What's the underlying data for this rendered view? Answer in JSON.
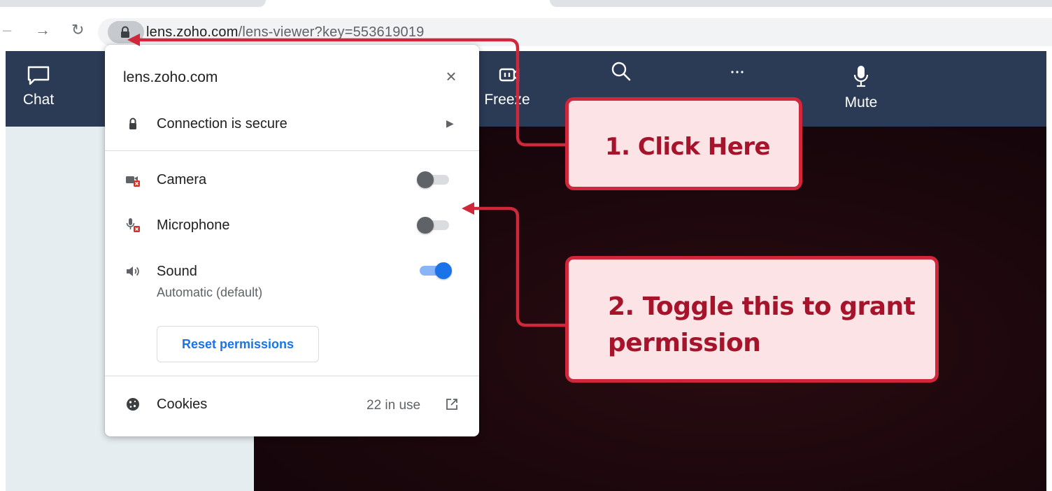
{
  "browser": {
    "url_host": "lens.zoho.com",
    "url_path": "/lens-viewer?key=553619019"
  },
  "app_header": {
    "chat_label": "Chat",
    "freeze_label": "Freeze",
    "mute_label": "Mute"
  },
  "popup": {
    "title": "lens.zoho.com",
    "close_glyph": "×",
    "connection_label": "Connection is secure",
    "permissions": [
      {
        "label": "Camera",
        "enabled": false,
        "icon": "camera-blocked-icon"
      },
      {
        "label": "Microphone",
        "enabled": false,
        "icon": "microphone-blocked-icon"
      },
      {
        "label": "Sound",
        "sublabel": "Automatic (default)",
        "enabled": true,
        "icon": "speaker-icon"
      }
    ],
    "reset_label": "Reset permissions",
    "cookies_label": "Cookies",
    "cookies_count": "22 in use"
  },
  "annotations": {
    "step1": "1. Click Here",
    "step2": "2. Toggle this to grant permission"
  },
  "colors": {
    "header_bg": "#2b3a55",
    "annotation_red": "#d0273a",
    "annotation_fill": "#fbe3e6",
    "toggle_on": "#1a73e8",
    "link_blue": "#1a73e8"
  }
}
